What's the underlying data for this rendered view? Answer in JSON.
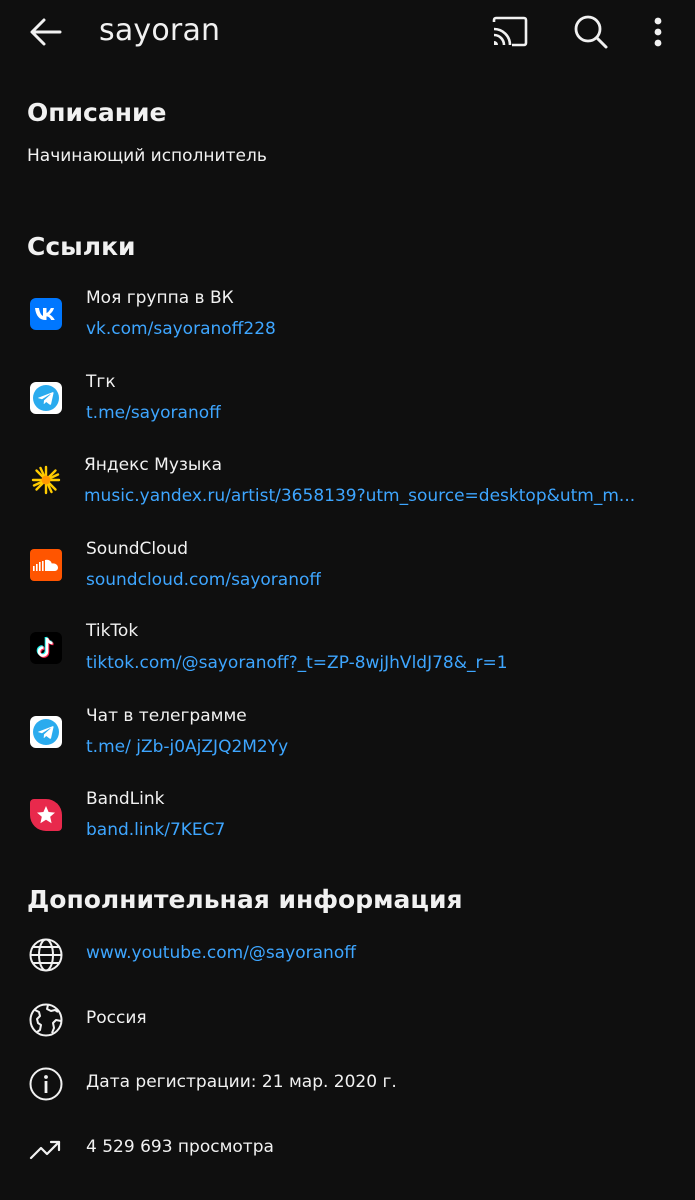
{
  "header": {
    "title": "sayoran",
    "back_icon": "arrow-left-icon",
    "cast_icon": "cast-icon",
    "search_icon": "search-icon",
    "more_icon": "more-vert-icon"
  },
  "description": {
    "heading": "Описание",
    "text": "Начинающий исполнитель"
  },
  "links": {
    "heading": "Ссылки",
    "items": [
      {
        "name": "Моя группа в ВК",
        "url": "vk.com/sayoranoff228",
        "icon": "vk-icon",
        "color": "#0077ff"
      },
      {
        "name": "Тгк",
        "url": "t.me/sayoranoff",
        "icon": "telegram-icon",
        "color": "#2aabee"
      },
      {
        "name": "Яндекс Музыка",
        "url": "music.yandex.ru/artist/3658139?utm_source=desktop&utm_m...",
        "icon": "yandex-music-icon",
        "color": "#ffcc00"
      },
      {
        "name": "SoundCloud",
        "url": "soundcloud.com/sayoranoff",
        "icon": "soundcloud-icon",
        "color": "#ff5500"
      },
      {
        "name": "TikTok",
        "url": "tiktok.com/@sayoranoff?_t=ZP-8wjJhVldJ78&_r=1",
        "icon": "tiktok-icon",
        "color": "#000000"
      },
      {
        "name": "Чат в телеграмме",
        "url": "t.me/ jZb-j0AjZJQ2M2Yy",
        "icon": "telegram-icon",
        "color": "#2aabee"
      },
      {
        "name": "BandLink",
        "url": "band.link/7KEC7",
        "icon": "bandlink-icon",
        "color": "#e8294c"
      }
    ]
  },
  "additional": {
    "heading": "Дополнительная информация",
    "website": "www.youtube.com/@sayoranoff",
    "country": "Россия",
    "registered": "Дата регистрации: 21 мар. 2020 г.",
    "views": "4 529 693 просмотра",
    "icons": [
      "globe-icon",
      "world-map-icon",
      "info-icon",
      "trending-icon"
    ]
  },
  "colors": {
    "background": "#0f0f0f",
    "text": "#f1f1f1",
    "link": "#3ea6ff"
  }
}
